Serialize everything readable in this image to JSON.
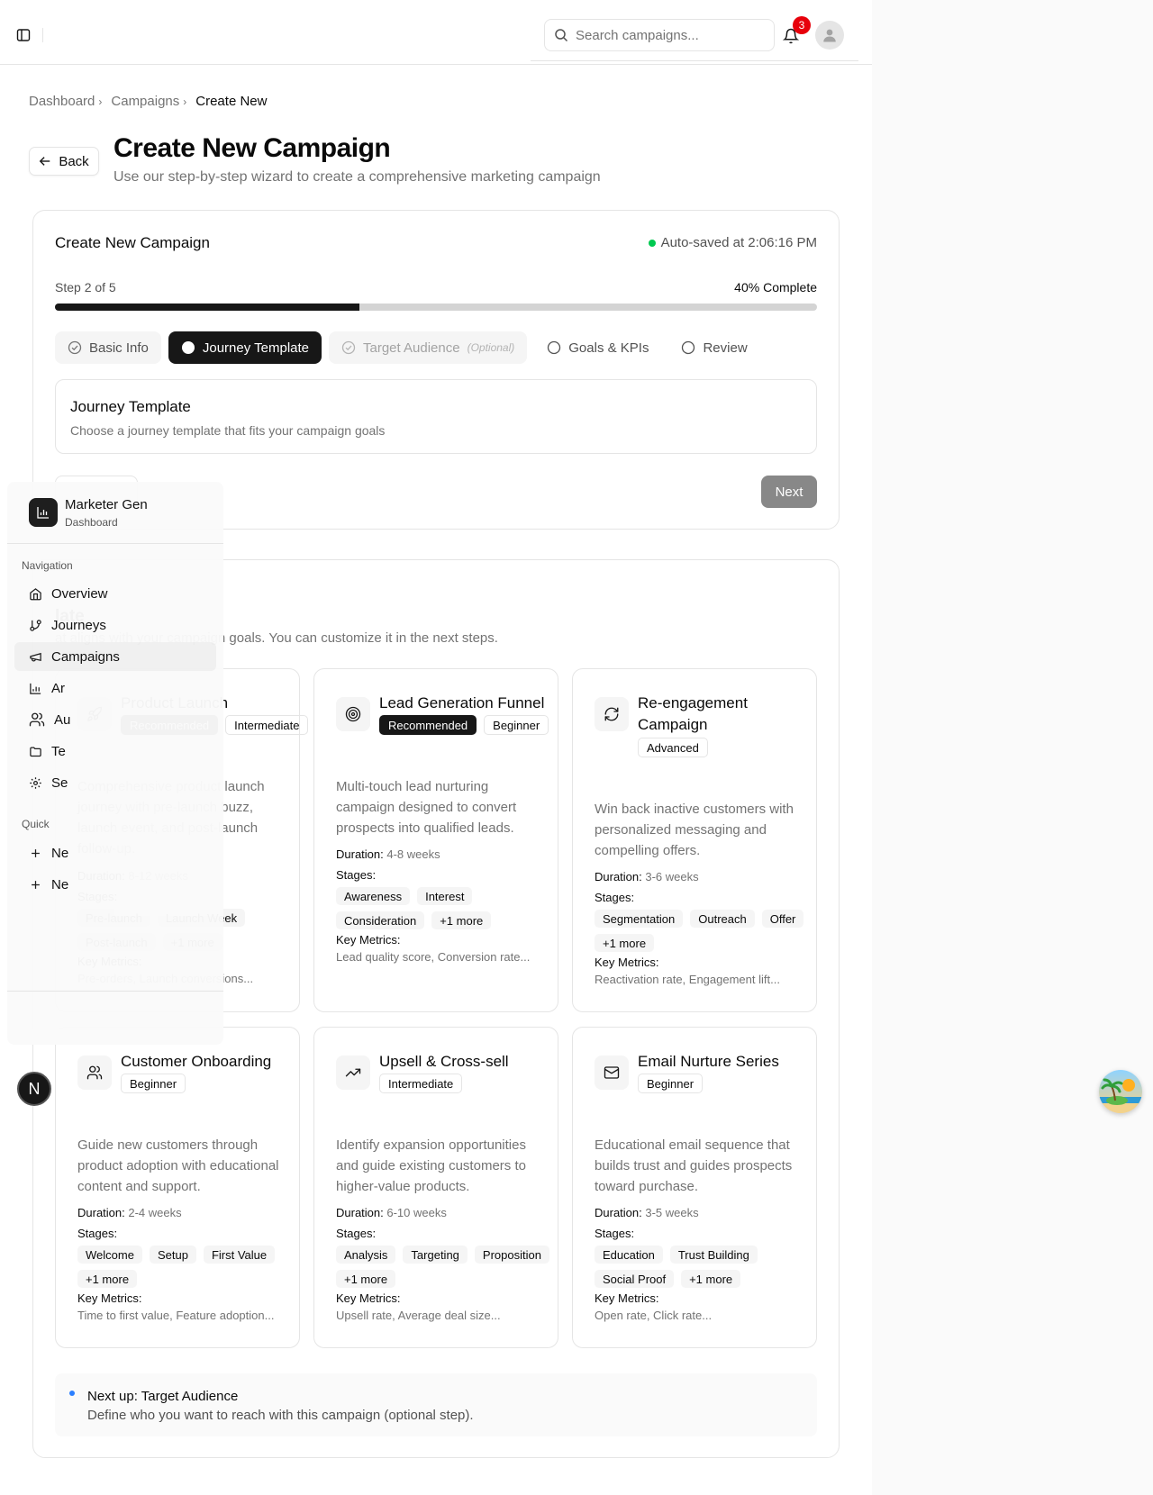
{
  "header": {
    "search_placeholder": "Search campaigns...",
    "notification_count": "3"
  },
  "breadcrumb": [
    "Dashboard",
    "Campaigns",
    "Create New"
  ],
  "page": {
    "back_label": "Back",
    "title": "Create New Campaign",
    "subtitle": "Use our step-by-step wizard to create a comprehensive marketing campaign"
  },
  "wizard": {
    "title": "Create New Campaign",
    "autosave": "Auto-saved at 2:06:16 PM",
    "step_label": "Step 2 of 5",
    "percent_label": "40% Complete",
    "progress": 0.4,
    "steps": [
      {
        "label": "Basic Info",
        "state": "done"
      },
      {
        "label": "Journey Template",
        "state": "active"
      },
      {
        "label": "Target Audience",
        "optional": "(Optional)",
        "state": "disabled"
      },
      {
        "label": "Goals & KPIs",
        "state": "pending"
      },
      {
        "label": "Review",
        "state": "pending"
      }
    ],
    "section_title": "Journey Template",
    "section_desc": "Choose a journey template that fits your campaign goals",
    "next_label": "Next"
  },
  "templates": {
    "title": "late",
    "subtitle": "at aligns with your campaign goals. You can customize it in the next steps.",
    "duration_label": "Duration:",
    "stages_label": "Stages:",
    "metrics_label": "Key Metrics:",
    "items": [
      {
        "name": "Product Launch",
        "icon": "rocket-icon",
        "badges": [
          "Recommended",
          "Intermediate"
        ],
        "desc": "Comprehensive product launch journey with pre-launch buzz, launch event, and post-launch follow-up.",
        "duration": "8-12 weeks",
        "stages": [
          "Pre-launch",
          "Launch Week",
          "Post-launch",
          "+1 more"
        ],
        "metrics": "Pre-orders, Launch conversions..."
      },
      {
        "name": "Lead Generation Funnel",
        "icon": "target-icon",
        "badges": [
          "Recommended",
          "Beginner"
        ],
        "desc": "Multi-touch lead nurturing campaign designed to convert prospects into qualified leads.",
        "duration": "4-8 weeks",
        "stages": [
          "Awareness",
          "Interest",
          "Consideration",
          "+1 more"
        ],
        "metrics": "Lead quality score, Conversion rate..."
      },
      {
        "name": "Re-engagement Campaign",
        "icon": "refresh-icon",
        "badges": [
          "Advanced"
        ],
        "desc": "Win back inactive customers with personalized messaging and compelling offers.",
        "duration": "3-6 weeks",
        "stages": [
          "Segmentation",
          "Outreach",
          "Offer",
          "+1 more"
        ],
        "metrics": "Reactivation rate, Engagement lift..."
      },
      {
        "name": "Customer Onboarding",
        "icon": "users-icon",
        "badges": [
          "Beginner"
        ],
        "desc": "Guide new customers through product adoption with educational content and support.",
        "duration": "2-4 weeks",
        "stages": [
          "Welcome",
          "Setup",
          "First Value",
          "+1 more"
        ],
        "metrics": "Time to first value, Feature adoption..."
      },
      {
        "name": "Upsell & Cross-sell",
        "icon": "trending-up-icon",
        "badges": [
          "Intermediate"
        ],
        "desc": "Identify expansion opportunities and guide existing customers to higher-value products.",
        "duration": "6-10 weeks",
        "stages": [
          "Analysis",
          "Targeting",
          "Proposition",
          "+1 more"
        ],
        "metrics": "Upsell rate, Average deal size..."
      },
      {
        "name": "Email Nurture Series",
        "icon": "mail-icon",
        "badges": [
          "Beginner"
        ],
        "desc": "Educational email sequence that builds trust and guides prospects toward purchase.",
        "duration": "3-5 weeks",
        "stages": [
          "Education",
          "Trust Building",
          "Social Proof",
          "+1 more"
        ],
        "metrics": "Open rate, Click rate..."
      }
    ]
  },
  "next_up": {
    "title": "Next up: Target Audience",
    "desc": "Define who you want to reach with this campaign (optional step)."
  },
  "sidebar": {
    "app_name": "Marketer Gen",
    "app_sub": "Dashboard",
    "nav_group": "Navigation",
    "items": [
      {
        "label": "Overview",
        "icon": "home-icon"
      },
      {
        "label": "Journeys",
        "icon": "git-branch-icon"
      },
      {
        "label": "Campaigns",
        "icon": "megaphone-icon"
      },
      {
        "label": "Ar",
        "icon": "bar-chart-icon"
      },
      {
        "label": "Au",
        "icon": "users-icon"
      },
      {
        "label": "Te",
        "icon": "folder-icon"
      },
      {
        "label": "Se",
        "icon": "gear-icon"
      }
    ],
    "quick_group": "Quick",
    "quick_items": [
      "Ne",
      "Ne"
    ]
  },
  "fab_letter": "N"
}
